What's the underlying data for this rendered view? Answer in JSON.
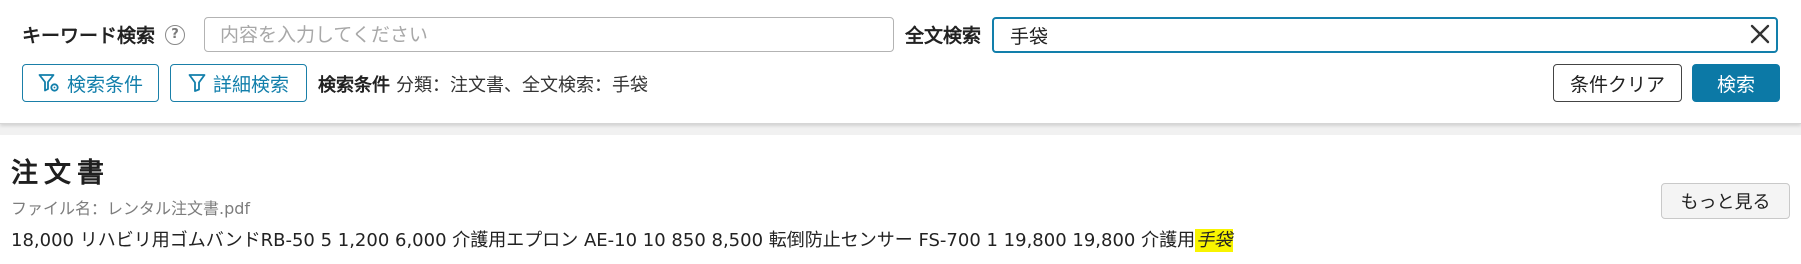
{
  "search": {
    "keyword_label": "キーワード検索",
    "help_icon": "?",
    "keyword_placeholder": "内容を入力してください",
    "keyword_value": "",
    "fulltext_label": "全文検索",
    "fulltext_value": "手袋",
    "clear_icon": "close-icon"
  },
  "toolbar": {
    "conditions_button": "検索条件",
    "detail_button": "詳細検索",
    "summary_label": "検索条件",
    "summary_value": "分類：注文書、全文検索：手袋",
    "clear_button": "条件クリア",
    "search_button": "検索"
  },
  "result": {
    "title": "注文書",
    "file_name": "ファイル名：レンタル注文書.pdf",
    "snippet_before": "18,000 リハビリ用ゴムバンドRB-50 5 1,200 6,000 介護用エプロン AE-10 10 850 8,500 転倒防止センサー FS-700 1 19,800 19,800 介護用",
    "snippet_highlight": "手袋",
    "more_button": "もっと見る"
  },
  "colors": {
    "accent": "#0c79a6",
    "highlight": "#f8f400"
  }
}
